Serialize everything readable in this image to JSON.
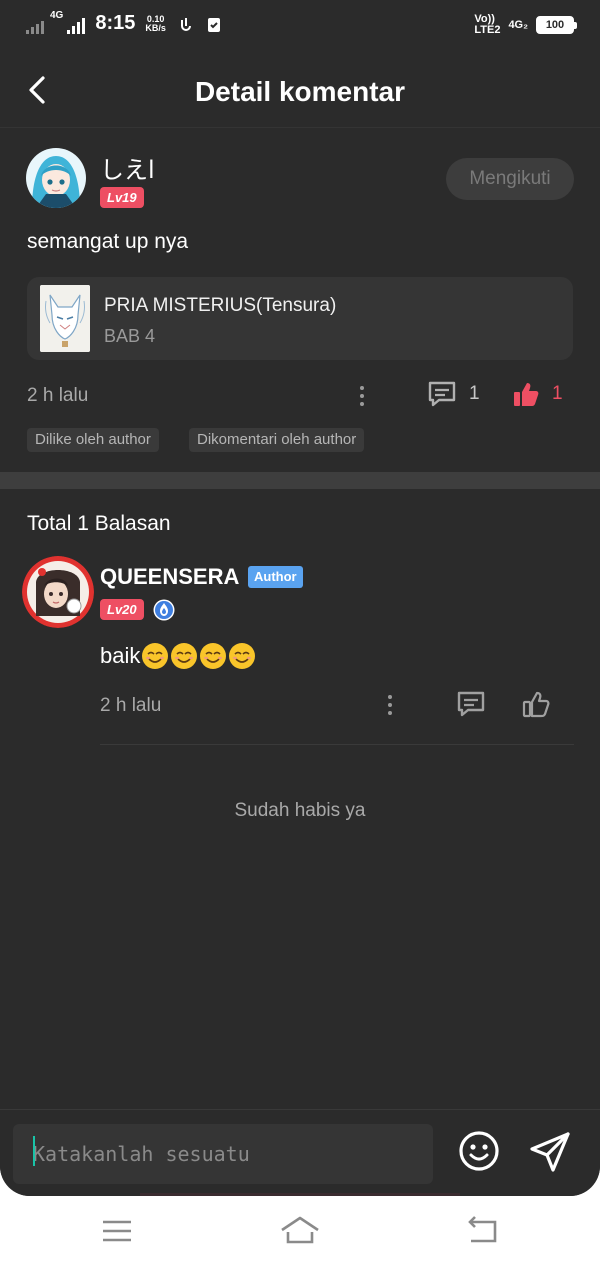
{
  "status_bar": {
    "network_left": "4G",
    "network_left2": "4G",
    "time": "8:15",
    "speed_value": "0.10",
    "speed_unit": "KB/s",
    "volte": "Vo))",
    "lte": "LTE2",
    "network_right": "4G₂",
    "battery": "100"
  },
  "header": {
    "title": "Detail komentar",
    "back_icon": "chevron-left-icon"
  },
  "comment": {
    "username": "しえl",
    "level": "Lv19",
    "follow_label": "Mengikuti",
    "text": "semangat up nya",
    "book": {
      "title": "PRIA MISTERIUS(Tensura)",
      "chapter": "BAB 4"
    },
    "time": "2 h lalu",
    "reply_count": "1",
    "like_count": "1",
    "tags": [
      "Dilike oleh author",
      "Dikomentari oleh author"
    ]
  },
  "replies": {
    "total_label": "Total 1 Balasan",
    "items": [
      {
        "username": "QUEENSERA",
        "badge": "Author",
        "level": "Lv20",
        "text": "baik",
        "time": "2 h lalu"
      }
    ],
    "end_note": "Sudah habis ya"
  },
  "input": {
    "placeholder": "Katakanlah sesuatu"
  },
  "colors": {
    "background": "#2b2b2b",
    "accent": "#ee4f63",
    "author_badge": "#5aa3f0",
    "caret": "#19c3a7"
  }
}
